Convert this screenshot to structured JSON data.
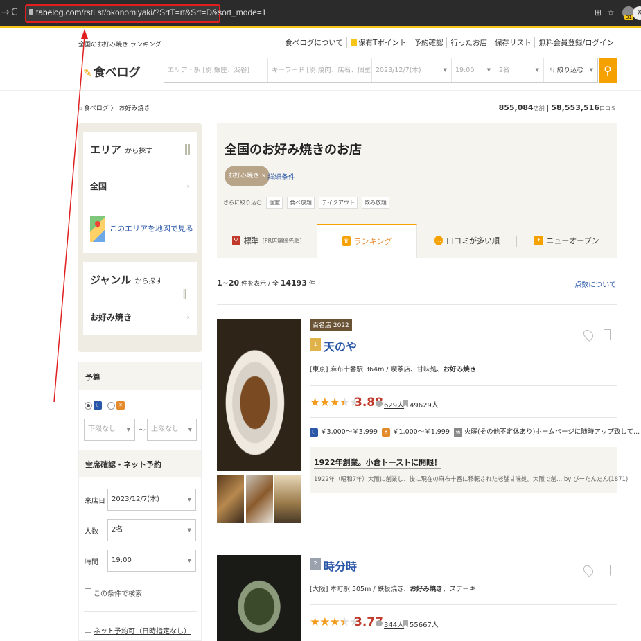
{
  "browser": {
    "url_host": "tabelog.com",
    "url_path": "/rstLst/okonomiyaki/?SrtT=rt&Srt=D&sort_mode=1",
    "avatar_badge": "31"
  },
  "header": {
    "tagline": "全国のお好み焼き ランキング",
    "links": [
      "食べログについて",
      "保有Tポイント",
      "予約確認",
      "行ったお店",
      "保存リスト",
      "無料会員登録/ログイン"
    ],
    "logo": "食べログ",
    "search": {
      "area_placeholder": "エリア・駅 [例:銀座、渋谷]",
      "keyword_placeholder": "キーワード [例:焼肉、店名、個室]",
      "date": "2023/12/7(木)",
      "time": "19:00",
      "people": "2名",
      "filter": "絞り込む"
    }
  },
  "breadcrumb": {
    "home": "食べログ",
    "current": "お好み焼き"
  },
  "counts": {
    "shops": "855,084",
    "shops_unit": "店舗",
    "reviews": "58,553,516",
    "reviews_unit": "口コミ"
  },
  "sidebar": {
    "area_head": "エリア",
    "area_sub": "から探す",
    "area_value": "全国",
    "map_link": "このエリアを地図で見る",
    "genre_head": "ジャンル",
    "genre_sub": "から探す",
    "genre_value": "お好み焼き",
    "budget_head": "予算",
    "budget_min": "下限なし",
    "budget_max": "上限なし",
    "budget_sep": "〜",
    "reserve_head": "空席確認・ネット予約",
    "date_label": "来店日",
    "date_value": "2023/12/7(木)",
    "people_label": "人数",
    "people_value": "2名",
    "time_label": "時間",
    "time_value": "19:00",
    "search_check": "この条件で検索",
    "net_reserve": "ネット予約可（日時指定なし）"
  },
  "main": {
    "title": "全国のお好み焼きのお店",
    "tag": "お好み焼き ×",
    "detail_link": "詳細条件",
    "filter_label": "さらに絞り込む",
    "filter_chips": [
      "個室",
      "食べ放題",
      "テイクアウト",
      "飲み放題"
    ],
    "tabs": [
      {
        "label": "標準",
        "sub": "[PR店舗優先順]"
      },
      {
        "label": "ランキング",
        "sub": ""
      },
      {
        "label": "口コミが多い順",
        "sub": ""
      },
      {
        "label": "ニューオープン",
        "sub": ""
      }
    ],
    "result_range": "1~20",
    "result_mid": "件を表示 / 全",
    "result_total": "14193",
    "result_unit": "件",
    "score_link": "点数について"
  },
  "listings": [
    {
      "award": "百名店 2022",
      "rank": "1",
      "name": "天のや",
      "area": "[東京] 麻布十番駅 364m / 喫茶店、甘味処、",
      "genre_bold": "お好み焼き",
      "rating": "3.88",
      "rating_value": 3.88,
      "reviews": "629人",
      "bookmarks": "49629人",
      "dinner_price": "￥3,000～￥3,999",
      "lunch_price": "￥1,000～￥1,999",
      "holiday": "火曜(その他不定休あり)ホームページに随時アップ致して...",
      "holiday_icon": "休",
      "pr_title": "1922年創業。小倉トーストに開眼！",
      "pr_text": "1922年（昭和7年）大阪に創業し、後に現在の麻布十番に移転された老舗甘味処。大阪で創...",
      "pr_author": "by ぴーたんたん(1871)"
    },
    {
      "rank": "2",
      "name": "時分時",
      "area": "[大阪] 本町駅 505m / 鉄板焼き、",
      "genre_bold": "お好み焼き",
      "genre_after": "、ステーキ",
      "rating": "3.77",
      "rating_value": 3.77,
      "reviews": "344人",
      "bookmarks": "55667人"
    }
  ],
  "colors": {
    "accent": "#f5a100",
    "link": "#2a57a8",
    "rating": "#c0392b",
    "annotation": "#e02020"
  }
}
